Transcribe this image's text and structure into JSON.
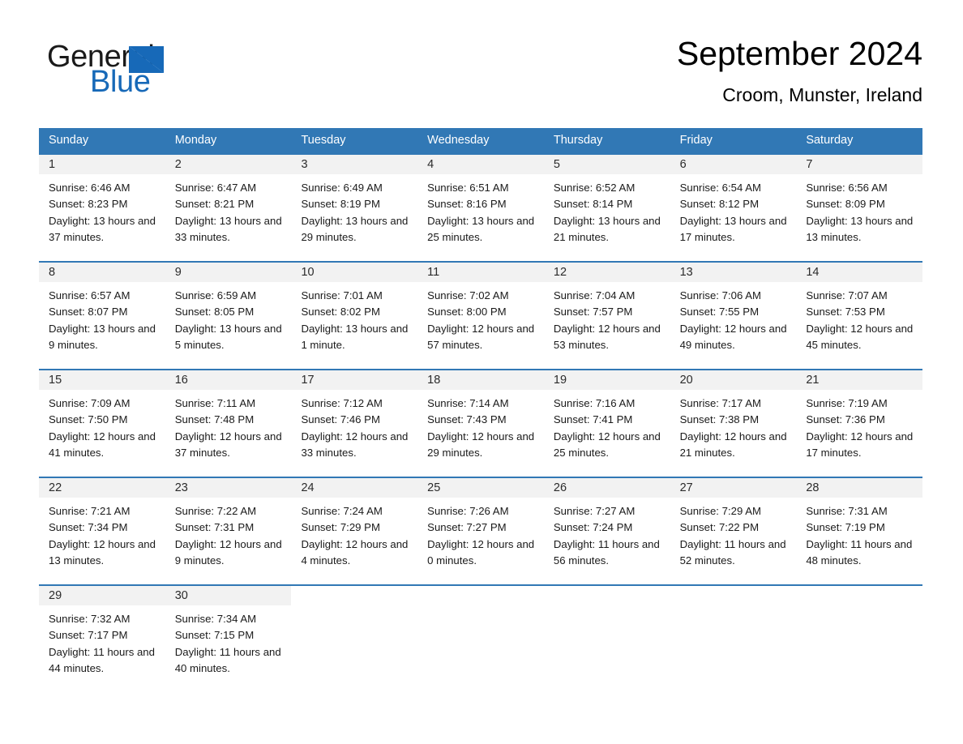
{
  "brand": {
    "word_one": "General",
    "word_two": "Blue",
    "triangle_color": "#1769b8",
    "text_color": "#1a1a1a"
  },
  "header": {
    "title": "September 2024",
    "subtitle": "Croom, Munster, Ireland"
  },
  "theme": {
    "header_blue": "#3178b5",
    "day_band_gray": "#f2f2f2",
    "body_background": "#ffffff"
  },
  "weekdays": [
    "Sunday",
    "Monday",
    "Tuesday",
    "Wednesday",
    "Thursday",
    "Friday",
    "Saturday"
  ],
  "weeks": [
    [
      {
        "date": "1",
        "sunrise": "Sunrise: 6:46 AM",
        "sunset": "Sunset: 8:23 PM",
        "daylight": "Daylight: 13 hours and 37 minutes."
      },
      {
        "date": "2",
        "sunrise": "Sunrise: 6:47 AM",
        "sunset": "Sunset: 8:21 PM",
        "daylight": "Daylight: 13 hours and 33 minutes."
      },
      {
        "date": "3",
        "sunrise": "Sunrise: 6:49 AM",
        "sunset": "Sunset: 8:19 PM",
        "daylight": "Daylight: 13 hours and 29 minutes."
      },
      {
        "date": "4",
        "sunrise": "Sunrise: 6:51 AM",
        "sunset": "Sunset: 8:16 PM",
        "daylight": "Daylight: 13 hours and 25 minutes."
      },
      {
        "date": "5",
        "sunrise": "Sunrise: 6:52 AM",
        "sunset": "Sunset: 8:14 PM",
        "daylight": "Daylight: 13 hours and 21 minutes."
      },
      {
        "date": "6",
        "sunrise": "Sunrise: 6:54 AM",
        "sunset": "Sunset: 8:12 PM",
        "daylight": "Daylight: 13 hours and 17 minutes."
      },
      {
        "date": "7",
        "sunrise": "Sunrise: 6:56 AM",
        "sunset": "Sunset: 8:09 PM",
        "daylight": "Daylight: 13 hours and 13 minutes."
      }
    ],
    [
      {
        "date": "8",
        "sunrise": "Sunrise: 6:57 AM",
        "sunset": "Sunset: 8:07 PM",
        "daylight": "Daylight: 13 hours and 9 minutes."
      },
      {
        "date": "9",
        "sunrise": "Sunrise: 6:59 AM",
        "sunset": "Sunset: 8:05 PM",
        "daylight": "Daylight: 13 hours and 5 minutes."
      },
      {
        "date": "10",
        "sunrise": "Sunrise: 7:01 AM",
        "sunset": "Sunset: 8:02 PM",
        "daylight": "Daylight: 13 hours and 1 minute."
      },
      {
        "date": "11",
        "sunrise": "Sunrise: 7:02 AM",
        "sunset": "Sunset: 8:00 PM",
        "daylight": "Daylight: 12 hours and 57 minutes."
      },
      {
        "date": "12",
        "sunrise": "Sunrise: 7:04 AM",
        "sunset": "Sunset: 7:57 PM",
        "daylight": "Daylight: 12 hours and 53 minutes."
      },
      {
        "date": "13",
        "sunrise": "Sunrise: 7:06 AM",
        "sunset": "Sunset: 7:55 PM",
        "daylight": "Daylight: 12 hours and 49 minutes."
      },
      {
        "date": "14",
        "sunrise": "Sunrise: 7:07 AM",
        "sunset": "Sunset: 7:53 PM",
        "daylight": "Daylight: 12 hours and 45 minutes."
      }
    ],
    [
      {
        "date": "15",
        "sunrise": "Sunrise: 7:09 AM",
        "sunset": "Sunset: 7:50 PM",
        "daylight": "Daylight: 12 hours and 41 minutes."
      },
      {
        "date": "16",
        "sunrise": "Sunrise: 7:11 AM",
        "sunset": "Sunset: 7:48 PM",
        "daylight": "Daylight: 12 hours and 37 minutes."
      },
      {
        "date": "17",
        "sunrise": "Sunrise: 7:12 AM",
        "sunset": "Sunset: 7:46 PM",
        "daylight": "Daylight: 12 hours and 33 minutes."
      },
      {
        "date": "18",
        "sunrise": "Sunrise: 7:14 AM",
        "sunset": "Sunset: 7:43 PM",
        "daylight": "Daylight: 12 hours and 29 minutes."
      },
      {
        "date": "19",
        "sunrise": "Sunrise: 7:16 AM",
        "sunset": "Sunset: 7:41 PM",
        "daylight": "Daylight: 12 hours and 25 minutes."
      },
      {
        "date": "20",
        "sunrise": "Sunrise: 7:17 AM",
        "sunset": "Sunset: 7:38 PM",
        "daylight": "Daylight: 12 hours and 21 minutes."
      },
      {
        "date": "21",
        "sunrise": "Sunrise: 7:19 AM",
        "sunset": "Sunset: 7:36 PM",
        "daylight": "Daylight: 12 hours and 17 minutes."
      }
    ],
    [
      {
        "date": "22",
        "sunrise": "Sunrise: 7:21 AM",
        "sunset": "Sunset: 7:34 PM",
        "daylight": "Daylight: 12 hours and 13 minutes."
      },
      {
        "date": "23",
        "sunrise": "Sunrise: 7:22 AM",
        "sunset": "Sunset: 7:31 PM",
        "daylight": "Daylight: 12 hours and 9 minutes."
      },
      {
        "date": "24",
        "sunrise": "Sunrise: 7:24 AM",
        "sunset": "Sunset: 7:29 PM",
        "daylight": "Daylight: 12 hours and 4 minutes."
      },
      {
        "date": "25",
        "sunrise": "Sunrise: 7:26 AM",
        "sunset": "Sunset: 7:27 PM",
        "daylight": "Daylight: 12 hours and 0 minutes."
      },
      {
        "date": "26",
        "sunrise": "Sunrise: 7:27 AM",
        "sunset": "Sunset: 7:24 PM",
        "daylight": "Daylight: 11 hours and 56 minutes."
      },
      {
        "date": "27",
        "sunrise": "Sunrise: 7:29 AM",
        "sunset": "Sunset: 7:22 PM",
        "daylight": "Daylight: 11 hours and 52 minutes."
      },
      {
        "date": "28",
        "sunrise": "Sunrise: 7:31 AM",
        "sunset": "Sunset: 7:19 PM",
        "daylight": "Daylight: 11 hours and 48 minutes."
      }
    ],
    [
      {
        "date": "29",
        "sunrise": "Sunrise: 7:32 AM",
        "sunset": "Sunset: 7:17 PM",
        "daylight": "Daylight: 11 hours and 44 minutes."
      },
      {
        "date": "30",
        "sunrise": "Sunrise: 7:34 AM",
        "sunset": "Sunset: 7:15 PM",
        "daylight": "Daylight: 11 hours and 40 minutes."
      },
      {
        "date": "",
        "sunrise": "",
        "sunset": "",
        "daylight": ""
      },
      {
        "date": "",
        "sunrise": "",
        "sunset": "",
        "daylight": ""
      },
      {
        "date": "",
        "sunrise": "",
        "sunset": "",
        "daylight": ""
      },
      {
        "date": "",
        "sunrise": "",
        "sunset": "",
        "daylight": ""
      },
      {
        "date": "",
        "sunrise": "",
        "sunset": "",
        "daylight": ""
      }
    ]
  ]
}
